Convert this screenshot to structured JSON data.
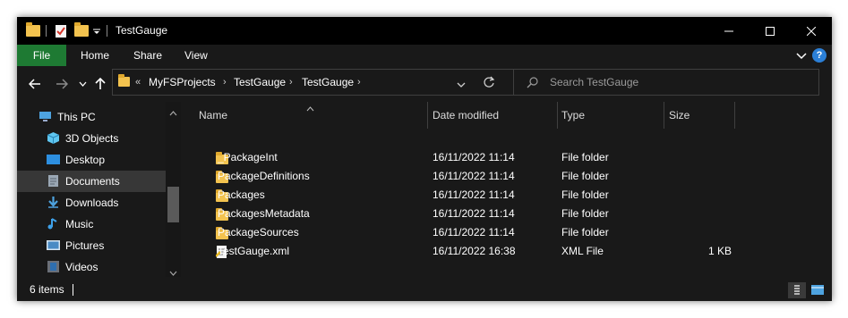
{
  "window": {
    "title": "TestGauge"
  },
  "ribbon": {
    "tabs": [
      "File",
      "Home",
      "Share",
      "View"
    ]
  },
  "address": {
    "overflow": "«",
    "crumbs": [
      "MyFSProjects",
      "TestGauge",
      "TestGauge"
    ],
    "separator": "›"
  },
  "search": {
    "placeholder": "Search TestGauge"
  },
  "nav": {
    "items": [
      {
        "label": "This PC",
        "icon": "this-pc-icon"
      },
      {
        "label": "3D Objects",
        "icon": "3d-objects-icon"
      },
      {
        "label": "Desktop",
        "icon": "desktop-icon"
      },
      {
        "label": "Documents",
        "icon": "documents-icon",
        "selected": true
      },
      {
        "label": "Downloads",
        "icon": "downloads-icon"
      },
      {
        "label": "Music",
        "icon": "music-icon"
      },
      {
        "label": "Pictures",
        "icon": "pictures-icon"
      },
      {
        "label": "Videos",
        "icon": "videos-icon"
      }
    ]
  },
  "table": {
    "columns": [
      "Name",
      "Date modified",
      "Type",
      "Size"
    ],
    "rows": [
      {
        "name": "_PackageInt",
        "date": "16/11/2022 11:14",
        "type": "File folder",
        "size": "",
        "icon": "folder-icon"
      },
      {
        "name": "PackageDefinitions",
        "date": "16/11/2022 11:14",
        "type": "File folder",
        "size": "",
        "icon": "folder-icon"
      },
      {
        "name": "Packages",
        "date": "16/11/2022 11:14",
        "type": "File folder",
        "size": "",
        "icon": "folder-icon"
      },
      {
        "name": "PackagesMetadata",
        "date": "16/11/2022 11:14",
        "type": "File folder",
        "size": "",
        "icon": "folder-icon"
      },
      {
        "name": "PackageSources",
        "date": "16/11/2022 11:14",
        "type": "File folder",
        "size": "",
        "icon": "folder-icon"
      },
      {
        "name": "TestGauge.xml",
        "date": "16/11/2022 16:38",
        "type": "XML File",
        "size": "1 KB",
        "icon": "xml-file-icon"
      }
    ]
  },
  "status": {
    "items_text": "6 items"
  },
  "colors": {
    "file_tab": "#1e7a33",
    "folder": "#f3c34f",
    "selection": "#373737",
    "background": "#191919"
  }
}
